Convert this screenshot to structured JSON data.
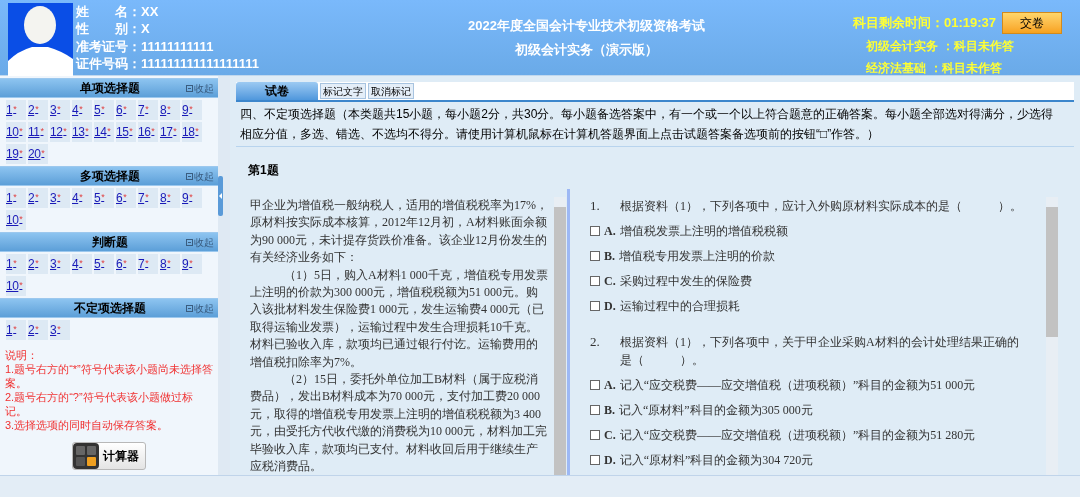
{
  "candidate": {
    "fields": [
      {
        "label": "姓　　名：",
        "value": "XX"
      },
      {
        "label": "性　　别：",
        "value": "X"
      },
      {
        "label": "准考证号：",
        "value": "11111111111"
      },
      {
        "label": "证件号码：",
        "value": "111111111111111111"
      }
    ]
  },
  "exam_title": [
    "2022年度全国会计专业技术初级资格考试",
    "初级会计实务（演示版）"
  ],
  "timer": {
    "label": "科目剩余时间：",
    "value": "01:19:37"
  },
  "submit_button": "交卷",
  "subjects": [
    {
      "name": "初级会计实务",
      "status": "：科目未作答"
    },
    {
      "name": "经济法基础",
      "status": "：科目未作答"
    }
  ],
  "sections": [
    {
      "title": "单项选择题",
      "collapse": "收起",
      "items": [
        {
          "n": "1",
          "mark": "*"
        },
        {
          "n": "2",
          "mark": "*"
        },
        {
          "n": "3",
          "mark": "*"
        },
        {
          "n": "4",
          "mark": "*"
        },
        {
          "n": "5",
          "mark": "*"
        },
        {
          "n": "6",
          "mark": "*"
        },
        {
          "n": "7",
          "mark": "*"
        },
        {
          "n": "8",
          "mark": "*"
        },
        {
          "n": "9",
          "mark": "*"
        },
        {
          "n": "10",
          "mark": "*"
        },
        {
          "n": "11",
          "mark": "*"
        },
        {
          "n": "12",
          "mark": "*"
        },
        {
          "n": "13",
          "mark": "*"
        },
        {
          "n": "14",
          "mark": "*"
        },
        {
          "n": "15",
          "mark": "*"
        },
        {
          "n": "16",
          "mark": "*"
        },
        {
          "n": "17",
          "mark": "*"
        },
        {
          "n": "18",
          "mark": "*"
        },
        {
          "n": "19",
          "mark": "*"
        },
        {
          "n": "20",
          "mark": "*"
        }
      ]
    },
    {
      "title": "多项选择题",
      "collapse": "收起",
      "items": [
        {
          "n": "1",
          "mark": "*"
        },
        {
          "n": "2",
          "mark": "*"
        },
        {
          "n": "3",
          "mark": "*"
        },
        {
          "n": "4",
          "mark": "*"
        },
        {
          "n": "5",
          "mark": "*"
        },
        {
          "n": "6",
          "mark": "*"
        },
        {
          "n": "7",
          "mark": "*"
        },
        {
          "n": "8",
          "mark": "*"
        },
        {
          "n": "9",
          "mark": "*"
        },
        {
          "n": "10",
          "mark": "*"
        }
      ]
    },
    {
      "title": "判断题",
      "collapse": "收起",
      "items": [
        {
          "n": "1",
          "mark": "*"
        },
        {
          "n": "2",
          "mark": "*"
        },
        {
          "n": "3",
          "mark": "*"
        },
        {
          "n": "4",
          "mark": "*"
        },
        {
          "n": "5",
          "mark": "*"
        },
        {
          "n": "6",
          "mark": "*"
        },
        {
          "n": "7",
          "mark": "*"
        },
        {
          "n": "8",
          "mark": "*"
        },
        {
          "n": "9",
          "mark": "*"
        },
        {
          "n": "10",
          "mark": "*"
        }
      ]
    },
    {
      "title": "不定项选择题",
      "collapse": "收起",
      "items": [
        {
          "n": "1",
          "mark": "*"
        },
        {
          "n": "2",
          "mark": "*"
        },
        {
          "n": "3",
          "mark": "*"
        }
      ]
    }
  ],
  "notes": [
    "说明：",
    "1.题号右方的“*”符号代表该小题尚未选择答案。",
    "2.题号右方的“?”符号代表该小题做过标记。",
    "3.选择选项的同时自动保存答案。"
  ],
  "calculator_button": "计算器",
  "tabs": [
    {
      "label": "试卷",
      "selected": true
    }
  ],
  "toolbar": [
    "标记文字",
    "取消标记"
  ],
  "instructions": "四、不定项选择题（本类题共15小题，每小题2分，共30分。每小题备选答案中，有一个或一个以上符合题意的正确答案。每小题全部选对得满分，少选得相应分值，多选、错选、不选均不得分。请使用计算机鼠标在计算机答题界面上点击试题答案备选项前的按钮“□”作答。）",
  "question_title": "第1题",
  "material": [
    "甲企业为增值税一般纳税人，适用的增值税税率为17%，原材料按实际成本核算，2012年12月初，A材料账面余额为90 000元，未计提存货跌价准备。该企业12月份发生的有关经济业务如下：",
    "（1）5日，购入A材料1 000千克，增值税专用发票上注明的价款为300 000元，增值税税额为51 000元。购入该批材料发生保险费1 000元，发生运输费4 000元（已取得运输业发票），运输过程中发生合理损耗10千克。材料已验收入库，款项均已通过银行付讫。运输费用的增值税扣除率为7%。",
    "（2）15日，委托外单位加工B材料（属于应税消费品），发出B材料成本为70 000元，支付加工费20 000元，取得的增值税专用发票上注明的增值税税额为3 400元，由受托方代收代缴的消费税为10 000元，材料加工完毕验收入库，款项均已支付。材料收回后用于继续生产应税消费品。"
  ],
  "questions": [
    {
      "number": "1.",
      "stem": "根据资料（1），下列各项中，应计入外购原材料实际成本的是（　　　）。",
      "options": [
        {
          "letter": "A.",
          "text": "增值税发票上注明的增值税税额",
          "checked": false
        },
        {
          "letter": "B.",
          "text": "增值税专用发票上注明的价款",
          "checked": false
        },
        {
          "letter": "C.",
          "text": "采购过程中发生的保险费",
          "checked": false
        },
        {
          "letter": "D.",
          "text": "运输过程中的合理损耗",
          "checked": false
        }
      ]
    },
    {
      "number": "2.",
      "stem": "根据资料（1），下列各项中，关于甲企业采购A材料的会计处理结果正确的是（　　　）。",
      "options": [
        {
          "letter": "A.",
          "text": "记入“应交税费——应交增值税（进项税额）”科目的金额为51 000元",
          "checked": false
        },
        {
          "letter": "B.",
          "text": "记入“原材料”科目的金额为305 000元",
          "checked": false
        },
        {
          "letter": "C.",
          "text": "记入“应交税费——应交增值税（进项税额）”科目的金额为51 280元",
          "checked": false
        },
        {
          "letter": "D.",
          "text": "记入“原材料”科目的金额为304 720元",
          "checked": false
        }
      ]
    }
  ]
}
